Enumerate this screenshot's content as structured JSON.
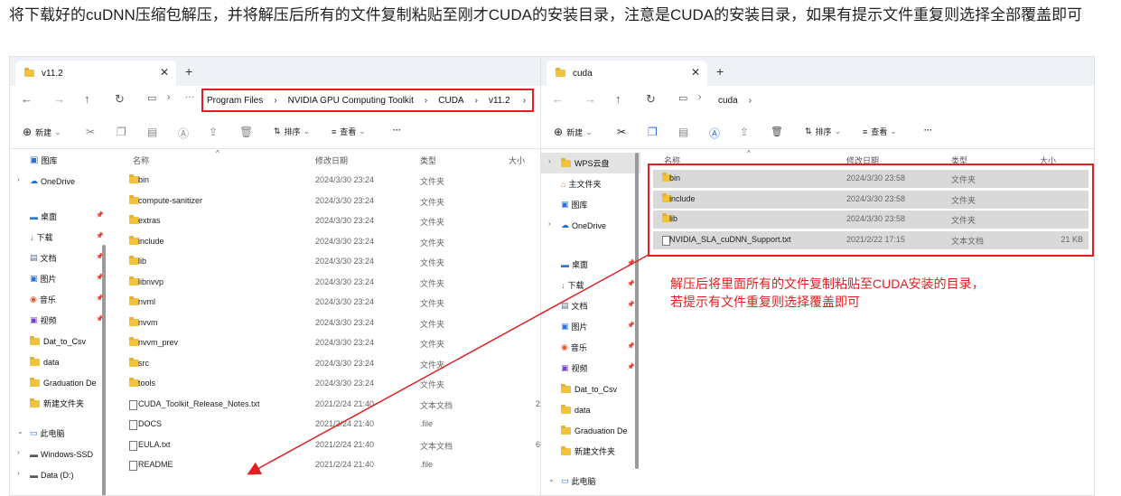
{
  "caption": "将下载好的cuDNN压缩包解压，并将解压后所有的文件复制粘贴至刚才CUDA的安装目录，注意是CUDA的安装目录，如果有提示文件重复则选择全部覆盖即可",
  "left_window": {
    "tab_title": "v11.2",
    "breadcrumb": [
      "Program Files",
      "NVIDIA GPU Computing Toolkit",
      "CUDA",
      "v11.2"
    ],
    "commands": {
      "new": "新建",
      "sort": "排序",
      "view": "查看",
      "more": "···"
    },
    "headers": {
      "name": "名称",
      "date": "修改日期",
      "type": "类型",
      "size": "大小"
    },
    "sidebar": [
      "图库",
      "OneDrive",
      "桌面",
      "下载",
      "文档",
      "图片",
      "音乐",
      "视频",
      "Dat_to_Csv",
      "data",
      "Graduation De",
      "新建文件夹",
      "此电脑",
      "Windows-SSD",
      "Data (D:)"
    ],
    "files": [
      {
        "name": "bin",
        "date": "2024/3/30 23:24",
        "type": "文件夹",
        "size": "",
        "kind": "folder"
      },
      {
        "name": "compute-sanitizer",
        "date": "2024/3/30 23:24",
        "type": "文件夹",
        "size": "",
        "kind": "folder"
      },
      {
        "name": "extras",
        "date": "2024/3/30 23:24",
        "type": "文件夹",
        "size": "",
        "kind": "folder"
      },
      {
        "name": "include",
        "date": "2024/3/30 23:24",
        "type": "文件夹",
        "size": "",
        "kind": "folder"
      },
      {
        "name": "lib",
        "date": "2024/3/30 23:24",
        "type": "文件夹",
        "size": "",
        "kind": "folder"
      },
      {
        "name": "libnvvp",
        "date": "2024/3/30 23:24",
        "type": "文件夹",
        "size": "",
        "kind": "folder"
      },
      {
        "name": "nvml",
        "date": "2024/3/30 23:24",
        "type": "文件夹",
        "size": "",
        "kind": "folder"
      },
      {
        "name": "nvvm",
        "date": "2024/3/30 23:24",
        "type": "文件夹",
        "size": "",
        "kind": "folder"
      },
      {
        "name": "nvvm_prev",
        "date": "2024/3/30 23:24",
        "type": "文件夹",
        "size": "",
        "kind": "folder"
      },
      {
        "name": "src",
        "date": "2024/3/30 23:24",
        "type": "文件夹",
        "size": "",
        "kind": "folder"
      },
      {
        "name": "tools",
        "date": "2024/3/30 23:24",
        "type": "文件夹",
        "size": "",
        "kind": "folder"
      },
      {
        "name": "CUDA_Toolkit_Release_Notes.txt",
        "date": "2021/2/24 21:40",
        "type": "文本文档",
        "size": "2",
        "kind": "doc"
      },
      {
        "name": "DOCS",
        "date": "2021/2/24 21:40",
        "type": ".file",
        "size": "",
        "kind": "doc"
      },
      {
        "name": "EULA.txt",
        "date": "2021/2/24 21:40",
        "type": "文本文档",
        "size": "6",
        "kind": "doc"
      },
      {
        "name": "README",
        "date": "2021/2/24 21:40",
        "type": ".file",
        "size": "",
        "kind": "doc"
      }
    ]
  },
  "right_window": {
    "tab_title": "cuda",
    "breadcrumb": [
      "cuda"
    ],
    "commands": {
      "new": "新建",
      "sort": "排序",
      "view": "查看",
      "more": "···"
    },
    "headers": {
      "name": "名称",
      "date": "修改日期",
      "type": "类型",
      "size": "大小"
    },
    "sidebar": [
      "WPS云盘",
      "主文件夹",
      "图库",
      "OneDrive",
      "桌面",
      "下载",
      "文档",
      "图片",
      "音乐",
      "视频",
      "Dat_to_Csv",
      "data",
      "Graduation De",
      "新建文件夹",
      "此电脑"
    ],
    "files": [
      {
        "name": "bin",
        "date": "2024/3/30 23:58",
        "type": "文件夹",
        "size": "",
        "kind": "folder"
      },
      {
        "name": "include",
        "date": "2024/3/30 23:58",
        "type": "文件夹",
        "size": "",
        "kind": "folder"
      },
      {
        "name": "lib",
        "date": "2024/3/30 23:58",
        "type": "文件夹",
        "size": "",
        "kind": "folder"
      },
      {
        "name": "NVIDIA_SLA_cuDNN_Support.txt",
        "date": "2021/2/22 17:15",
        "type": "文本文档",
        "size": "21 KB",
        "kind": "doc"
      }
    ]
  },
  "annotation": [
    "解压后将里面所有的文件复制粘贴至CUDA安装的目录，",
    "若提示有文件重复则选择覆盖即可"
  ],
  "colors": {
    "highlight": "#e02020",
    "folder": "#f2c23a"
  }
}
